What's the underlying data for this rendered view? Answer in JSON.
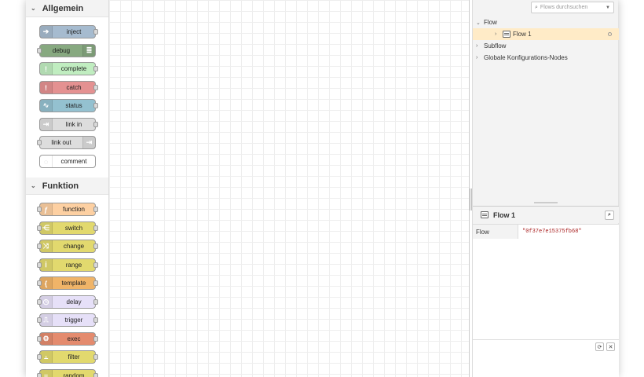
{
  "palette": {
    "categories": [
      {
        "label": "Allgemein",
        "nodes": [
          {
            "label": "inject",
            "color": "#a6bbcf",
            "icon": "arrow-right-icon",
            "icon_glyph": "➔",
            "icon_side": "left",
            "in": false,
            "out": true
          },
          {
            "label": "debug",
            "color": "#87a980",
            "icon": "list-icon",
            "icon_glyph": "≣",
            "icon_side": "right",
            "in": true,
            "out": false
          },
          {
            "label": "complete",
            "color": "#c0edc0",
            "icon": "exclamation-icon",
            "icon_glyph": "!",
            "icon_side": "left",
            "in": false,
            "out": true
          },
          {
            "label": "catch",
            "color": "#e49191",
            "icon": "exclamation-icon",
            "icon_glyph": "!",
            "icon_side": "left",
            "in": false,
            "out": true
          },
          {
            "label": "status",
            "color": "#94c1d0",
            "icon": "pulse-icon",
            "icon_glyph": "∿",
            "icon_side": "left",
            "in": false,
            "out": true
          },
          {
            "label": "link in",
            "color": "#dddddd",
            "icon": "link-icon",
            "icon_glyph": "⇥",
            "icon_side": "left",
            "in": false,
            "out": true
          },
          {
            "label": "link out",
            "color": "#dddddd",
            "icon": "link-icon",
            "icon_glyph": "⇥",
            "icon_side": "right",
            "in": true,
            "out": false
          },
          {
            "label": "comment",
            "color": "#ffffff",
            "icon": "comment-icon",
            "icon_glyph": "◌",
            "icon_side": "left",
            "in": false,
            "out": false
          }
        ]
      },
      {
        "label": "Funktion",
        "nodes": [
          {
            "label": "function",
            "color": "#fdd0a2",
            "icon": "function-icon",
            "icon_glyph": "ƒ",
            "icon_side": "left",
            "in": true,
            "out": true
          },
          {
            "label": "switch",
            "color": "#e2d96e",
            "icon": "switch-icon",
            "icon_glyph": "⋲",
            "icon_side": "left",
            "in": true,
            "out": true
          },
          {
            "label": "change",
            "color": "#e2d96e",
            "icon": "shuffle-icon",
            "icon_glyph": "⤨",
            "icon_side": "left",
            "in": true,
            "out": true
          },
          {
            "label": "range",
            "color": "#e2d96e",
            "icon": "range-icon",
            "icon_glyph": "ⅰ",
            "icon_side": "left",
            "in": true,
            "out": true
          },
          {
            "label": "template",
            "color": "#f0b468",
            "icon": "template-icon",
            "icon_glyph": "{",
            "icon_side": "left",
            "in": true,
            "out": true
          },
          {
            "label": "delay",
            "color": "#e6e0f8",
            "icon": "clock-icon",
            "icon_glyph": "◷",
            "icon_side": "left",
            "in": true,
            "out": true
          },
          {
            "label": "trigger",
            "color": "#e6e0f8",
            "icon": "trigger-icon",
            "icon_glyph": "⎍",
            "icon_side": "left",
            "in": true,
            "out": true
          },
          {
            "label": "exec",
            "color": "#e48b6e",
            "icon": "cog-icon",
            "icon_glyph": "⚙",
            "icon_side": "left",
            "in": true,
            "out": true
          },
          {
            "label": "filter",
            "color": "#e2d96e",
            "icon": "filter-icon",
            "icon_glyph": "⫠",
            "icon_side": "left",
            "in": true,
            "out": true
          },
          {
            "label": "random",
            "color": "#e2d96e",
            "icon": "random-icon",
            "icon_glyph": "≡",
            "icon_side": "left",
            "in": true,
            "out": true
          }
        ]
      }
    ]
  },
  "sidebar": {
    "search_placeholder": "Flows durchsuchen",
    "tree": {
      "flow_group": "Flow",
      "flow_item": "Flow 1",
      "subflow_group": "Subflow",
      "config_group": "Globale Konfigurations-Nodes"
    },
    "info": {
      "title": "Flow 1",
      "row_key": "Flow",
      "row_value": "\"0f37e7e15375fb68\""
    }
  }
}
